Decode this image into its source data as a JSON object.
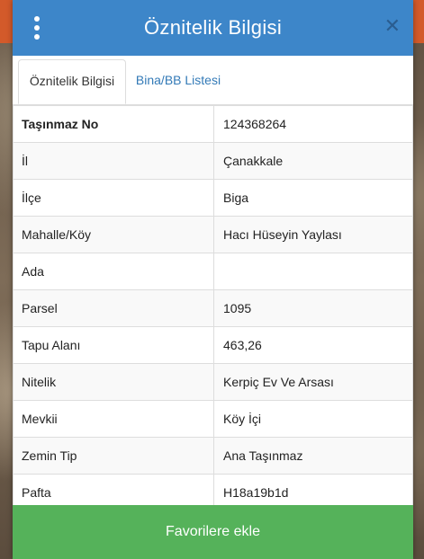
{
  "header": {
    "title": "Öznitelik Bilgisi",
    "menu_icon": "kebab-menu-icon",
    "close_icon": "close-icon"
  },
  "tabs": [
    {
      "label": "Öznitelik Bilgisi",
      "active": true
    },
    {
      "label": "Bina/BB Listesi",
      "active": false
    }
  ],
  "rows": [
    {
      "key": "Taşınmaz No",
      "value": "124368264"
    },
    {
      "key": "İl",
      "value": "Çanakkale"
    },
    {
      "key": "İlçe",
      "value": "Biga"
    },
    {
      "key": "Mahalle/Köy",
      "value": "Hacı Hüseyin Yaylası"
    },
    {
      "key": "Ada",
      "value": ""
    },
    {
      "key": "Parsel",
      "value": "1095"
    },
    {
      "key": "Tapu Alanı",
      "value": "463,26"
    },
    {
      "key": "Nitelik",
      "value": "Kerpiç Ev Ve Arsası"
    },
    {
      "key": "Mevkii",
      "value": "Köy İçi"
    },
    {
      "key": "Zemin Tip",
      "value": "Ana Taşınmaz"
    },
    {
      "key": "Pafta",
      "value": "H18a19b1d"
    }
  ],
  "footer": {
    "button_label": "Favorilere ekle"
  },
  "colors": {
    "header": "#3d86c9",
    "button": "#55b25a",
    "tab_link": "#337ab7"
  }
}
